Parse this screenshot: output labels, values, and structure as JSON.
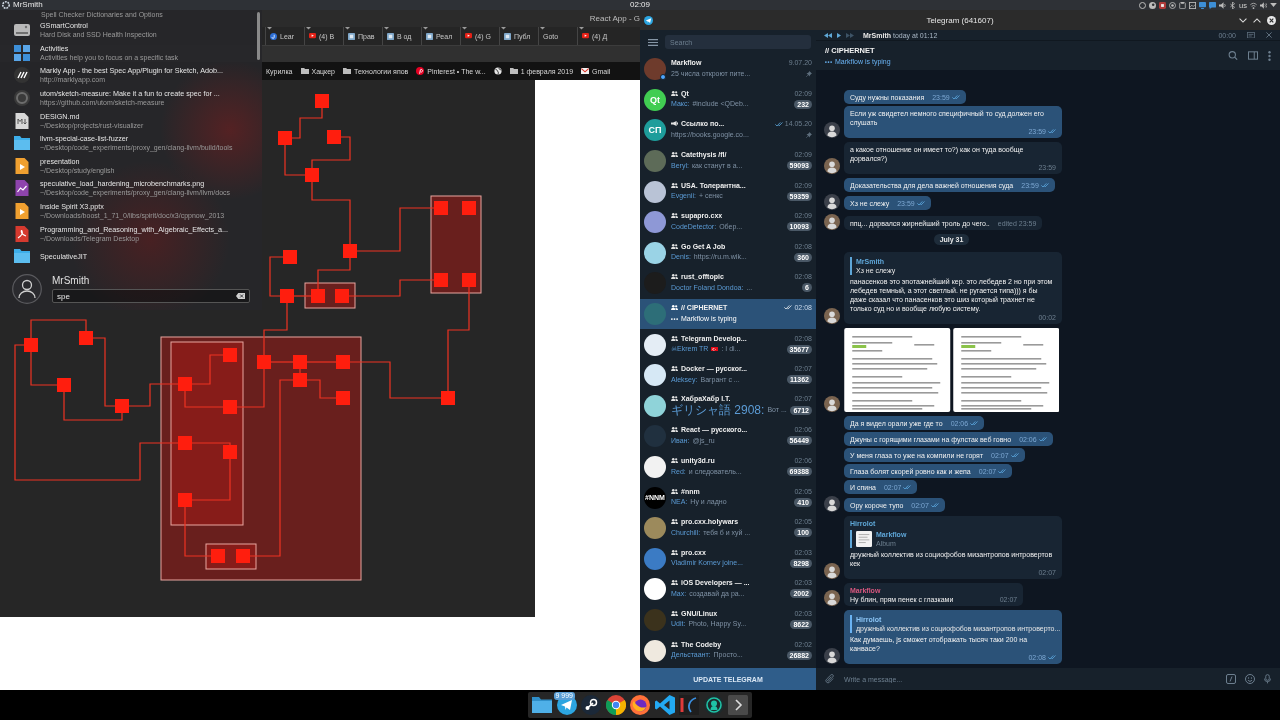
{
  "top_panel": {
    "user": "MrSmith",
    "clock": "02:09",
    "keyboard_layout": "us"
  },
  "launcher": {
    "results": [
      {
        "subtitle": "Spell Checker Dictionaries and Options"
      },
      {
        "title": "GSmartControl",
        "subtitle": "Hard Disk and SSD Health Inspection",
        "kind": "disk"
      },
      {
        "title": "Activities",
        "subtitle": "Activities help you to focus on a specific task",
        "kind": "activities"
      },
      {
        "title": "Markly App - the best Spec App/Plugin for Sketch, Adob...",
        "subtitle": "http://marklyapp.com",
        "kind": "website"
      },
      {
        "title": "utom/sketch-measure: Make it a fun to create spec for ...",
        "subtitle": "https://github.com/utom/sketch-measure",
        "kind": "repository"
      },
      {
        "title": "DESIGN.md",
        "subtitle": "~/Desktop/projects/rust-visualizer",
        "kind": "markdown"
      },
      {
        "title": "llvm-special-case-list-fuzzer",
        "subtitle": "~/Desktop/code_experiments/proxy_gen/clang-llvm/build/tools",
        "kind": "folder"
      },
      {
        "title": "presentation",
        "subtitle": "~/Desktop/study/english",
        "kind": "slides"
      },
      {
        "title": "speculative_load_hardening_microbenchmarks.png",
        "subtitle": "~/Desktop/code_experiments/proxy_gen/clang-llvm/llvm/docs",
        "kind": "image"
      },
      {
        "title": "Inside Spirit X3.pptx",
        "subtitle": "~/Downloads/boost_1_71_0/libs/spirit/doc/x3/cppnow_2013",
        "kind": "slides"
      },
      {
        "title": "Programming_and_Reasoning_with_Algebraic_Effects_a...",
        "subtitle": "~/Downloads/Telegram Desktop",
        "kind": "pdf"
      },
      {
        "title": "SpeculativeJIT",
        "kind": "folder"
      }
    ],
    "user": "MrSmith",
    "search": {
      "value": "spe"
    }
  },
  "browser": {
    "title": "React App - G",
    "tabs": [
      {
        "label": "Lear",
        "kind": "site"
      },
      {
        "label": "(4) В",
        "kind": "video"
      },
      {
        "label": "Прав",
        "kind": "page"
      },
      {
        "label": "В од",
        "kind": "page"
      },
      {
        "label": "Реал",
        "kind": "page"
      },
      {
        "label": "(4) G",
        "kind": "video"
      },
      {
        "label": "Публ",
        "kind": "page"
      },
      {
        "label": "Goto",
        "kind": "blank"
      },
      {
        "label": "(4) Д",
        "kind": "video"
      }
    ],
    "bookmarks": [
      {
        "label": "Курилка",
        "kind": "link"
      },
      {
        "label": "Хацкер",
        "kind": "folder"
      },
      {
        "label": "Технологии япов",
        "kind": "folder"
      },
      {
        "label": "Pinterest • The w...",
        "kind": "site"
      },
      {
        "kind": "globe"
      },
      {
        "label": "1 февраля 2019",
        "kind": "folder"
      },
      {
        "label": "Gmail",
        "kind": "mail"
      }
    ]
  },
  "telegram": {
    "window_title": "Telegram (641607)",
    "search": {
      "placeholder": "Search"
    },
    "chats": [
      {
        "name": "Markflow",
        "kind": "user",
        "time": "9.07.20",
        "preview": {
          "text": "25 числа откроют пите..."
        },
        "pinned": true,
        "read": false,
        "online": true,
        "selected": false,
        "color": "#6e3b2c"
      },
      {
        "name": "Qt",
        "kind": "group",
        "time": "02:09",
        "preview": {
          "author": "Макс:",
          "text": "#include <QDeb..."
        },
        "unread": "232",
        "pinned": false,
        "read": false,
        "online": false,
        "selected": false,
        "color": "#41cd52",
        "avatar_text": "Qt"
      },
      {
        "name": "Ссылко по...",
        "kind": "channel",
        "time": "14.05.20",
        "preview": {
          "text": "https://books.google.co..."
        },
        "pinned": true,
        "read": true,
        "online": false,
        "selected": false,
        "color": "#1e9d9b",
        "avatar_text": "СП"
      },
      {
        "name": "Catethysis /fl/",
        "kind": "group",
        "time": "02:09",
        "preview": {
          "author": "Beryl:",
          "text": "как станут в а..."
        },
        "unread": "59093",
        "pinned": false,
        "read": false,
        "online": false,
        "selected": false,
        "color": "#5d6b58"
      },
      {
        "name": "USA. Толерантна...",
        "kind": "group",
        "time": "02:09",
        "preview": {
          "author": "Evgenii:",
          "text": "+ сенкс"
        },
        "unread": "59359",
        "pinned": false,
        "read": false,
        "online": false,
        "selected": false,
        "color": "#b9c3d6"
      },
      {
        "name": "supapro.cxx",
        "kind": "group",
        "time": "02:09",
        "preview": {
          "author": "CodeDetector:",
          "text": "Обер..."
        },
        "unread": "10093",
        "pinned": false,
        "read": false,
        "online": false,
        "selected": false,
        "color": "#8e98d6"
      },
      {
        "name": "Go Get A Job",
        "kind": "group",
        "time": "02:08",
        "preview": {
          "author": "Denis:",
          "text": "https://ru.m.wik..."
        },
        "unread": "360",
        "pinned": false,
        "read": false,
        "online": false,
        "selected": false,
        "color": "#9ad3e6"
      },
      {
        "name": "rust_offtopic",
        "kind": "group",
        "time": "02:08",
        "preview": {
          "author": "Doctor Foland Dondoa:",
          "text": "..."
        },
        "unread": "6",
        "pinned": false,
        "read": false,
        "online": false,
        "selected": false,
        "color": "#1c1c1c"
      },
      {
        "name": "// CIPHERNET",
        "kind": "group",
        "time": "02:08",
        "preview": {
          "typing": "Markflow is typing"
        },
        "pinned": false,
        "read": true,
        "online": false,
        "selected": true,
        "color": "#2d6e78"
      },
      {
        "name": "Telegram Develop...",
        "kind": "group",
        "time": "02:08",
        "preview": {
          "author": "☠Ekrem TR",
          "flag": true,
          "text": ": I di..."
        },
        "unread": "35677",
        "pinned": false,
        "read": false,
        "online": false,
        "selected": false,
        "color": "#e4edf5"
      },
      {
        "name": "Docker — русског...",
        "kind": "group",
        "time": "02:07",
        "preview": {
          "author": "Aleksey:",
          "text": "Вагрант с ..."
        },
        "unread": "11362",
        "pinned": false,
        "read": false,
        "online": false,
        "selected": false,
        "color": "#d6e8f5"
      },
      {
        "name": "ХабраХабр I.T.",
        "kind": "group",
        "time": "02:07",
        "preview": {
          "author": "ギリシャ語 2908:",
          "text": "Вот ..."
        },
        "unread": "6712",
        "pinned": false,
        "read": false,
        "online": false,
        "selected": false,
        "color": "#8fd3d9"
      },
      {
        "name": "React — русского...",
        "kind": "group",
        "time": "02:06",
        "preview": {
          "author": "Иван:",
          "text": "@js_ru"
        },
        "unread": "56449",
        "pinned": false,
        "read": false,
        "online": false,
        "selected": false,
        "color": "#20303f"
      },
      {
        "name": "unity3d.ru",
        "kind": "group",
        "time": "02:06",
        "preview": {
          "author": "Red:",
          "text": "и следователь..."
        },
        "unread": "69388",
        "pinned": false,
        "read": false,
        "online": false,
        "selected": false,
        "color": "#f2f2f2"
      },
      {
        "name": "#nnm",
        "kind": "group",
        "time": "02:05",
        "preview": {
          "author": "NEA:",
          "text": "Ну и ладно"
        },
        "unread": "410",
        "pinned": false,
        "read": false,
        "online": false,
        "selected": false,
        "color": "#000000",
        "avatar_text": "#NNM"
      },
      {
        "name": "pro.cxx.holywars",
        "kind": "group",
        "time": "02:05",
        "preview": {
          "author": "Churchill:",
          "text": "тебя б и хуй ..."
        },
        "unread": "100",
        "pinned": false,
        "read": false,
        "online": false,
        "selected": false,
        "color": "#9c8a5c"
      },
      {
        "name": "pro.cxx",
        "kind": "group",
        "time": "02:03",
        "preview": {
          "author": "Vladimir Kornev joine..."
        },
        "unread": "8298",
        "pinned": false,
        "read": false,
        "online": false,
        "selected": false,
        "color": "#3b7bc4"
      },
      {
        "name": "iOS Developers — ...",
        "kind": "group",
        "time": "02:03",
        "preview": {
          "author": "Max:",
          "text": "создавай да ра..."
        },
        "unread": "2002",
        "pinned": false,
        "read": false,
        "online": false,
        "selected": false,
        "color": "#ffffff"
      },
      {
        "name": "GNU/Linux",
        "kind": "group",
        "time": "02:03",
        "preview": {
          "author": "Udit:",
          "text": "Photo, Happy Sy..."
        },
        "unread": "8622",
        "pinned": false,
        "read": false,
        "online": false,
        "selected": false,
        "color": "#3b321c"
      },
      {
        "name": "The Codeby",
        "kind": "group",
        "time": "02:02",
        "preview": {
          "author": "Дельстаант:",
          "text": "Просто..."
        },
        "unread": "26882",
        "pinned": false,
        "read": false,
        "online": false,
        "selected": false,
        "color": "#efe9df"
      }
    ],
    "update_button": "UPDATE TELEGRAM",
    "player": {
      "track": "**MrSmith** today at 01:12",
      "time": "00:00"
    },
    "chat": {
      "title": "// CIPHERNET",
      "typing": "Markflow is typing"
    },
    "messages": [
      {
        "kind": "out",
        "text": "Суду нужны показания",
        "time": "23:59",
        "read": true,
        "avatar": false
      },
      {
        "kind": "out",
        "text": "Если уж свидетел немного специфичный то суд должен его слушать",
        "time": "23:59",
        "read": true,
        "avatar": true
      },
      {
        "kind": "in",
        "text": "а какое отношение он имеет то?) как он туда вообще дорвался?)",
        "time": "23:59",
        "read": false,
        "avatar": true
      },
      {
        "kind": "out",
        "text": "Доказательства для дела важней отношения суда",
        "time": "23:59",
        "read": true,
        "avatar": false
      },
      {
        "kind": "out",
        "text": "Хз не слежу",
        "time": "23:59",
        "read": true,
        "avatar": true
      },
      {
        "kind": "in",
        "text": "ппц... дорвался жирнейший троль до чего..",
        "time": "edited 23:59",
        "read": false,
        "avatar": true
      },
      {
        "kind": "date",
        "text": "July 31"
      },
      {
        "kind": "in",
        "reply": {
          "author": "MrSmith",
          "text": "Хз не слежу",
          "thumb": false
        },
        "text": "панасенков это эпотажнейший кер. это лебедев 2 но при этом лебедев темный, а этот светлый. не ругается типа))) я бы даже сказал что панасенков это шиз который трахнет не только суд но и вообще любую систему.",
        "time": "00:02",
        "read": false,
        "avatar": true
      },
      {
        "kind": "album",
        "images": [
          {
            "kind": "document"
          },
          {
            "kind": "document"
          }
        ],
        "avatar": true
      },
      {
        "kind": "out",
        "text": "Да я видел орали уже где то",
        "time": "02:06",
        "read": true,
        "avatar": false
      },
      {
        "kind": "out",
        "text": "Джуны с горящими глазами на фулстак веб говно",
        "time": "02:06",
        "read": true,
        "avatar": false
      },
      {
        "kind": "out",
        "text": "У меня глаза то уже на компили не горят",
        "time": "02:07",
        "read": true,
        "avatar": false
      },
      {
        "kind": "out",
        "text": "Глаза болят скорей ровно как и жепа",
        "time": "02:07",
        "read": true,
        "avatar": false
      },
      {
        "kind": "out",
        "text": "И спина",
        "time": "02:07",
        "read": true,
        "avatar": false
      },
      {
        "kind": "out",
        "text": "Ору короче тупо",
        "time": "02:07",
        "read": true,
        "avatar": true
      },
      {
        "kind": "in",
        "author": "Hirrolot",
        "color": "#5fa8d8",
        "reply": {
          "author": "Markflow",
          "text": "Album",
          "thumb": true
        },
        "text": "дружный коллектив из социофобов мизантропов интровертов кек",
        "time": "02:07",
        "read": false,
        "avatar": true
      },
      {
        "kind": "in",
        "author": "Markflow",
        "color": "#d9577f",
        "text": "Ну блин, прям пенек с глазками",
        "time": "02:07",
        "read": false,
        "avatar": true
      },
      {
        "kind": "out",
        "reply": {
          "author": "Hirrolot",
          "text": "дружный коллектив из социофобов мизантропов интроверто...",
          "thumb": false
        },
        "text": "Как думаешь, js сможет отображать тысяч таки 200 на канвасе?",
        "time": "02:08",
        "read": true,
        "avatar": true
      }
    ],
    "composer": {
      "placeholder": "Write a message..."
    }
  },
  "taskbar": {
    "badge": "9 999"
  }
}
